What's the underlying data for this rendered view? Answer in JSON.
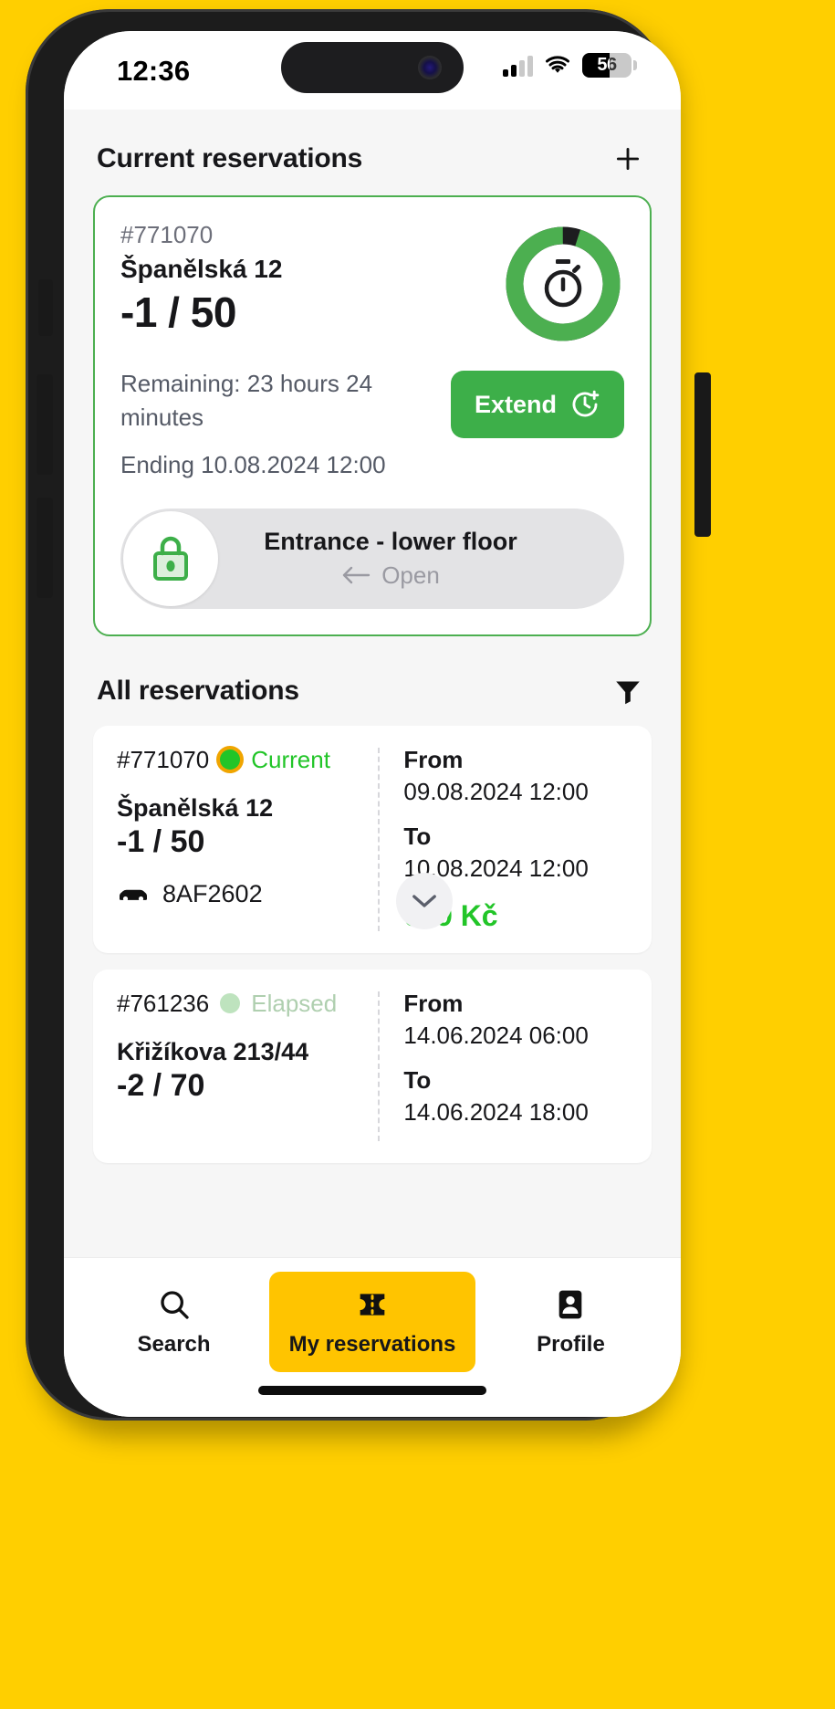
{
  "status_bar": {
    "time": "12:36",
    "battery_percent": "56",
    "battery_level": 56,
    "signal_icon": "cellular-signal-icon",
    "wifi_icon": "wifi-icon"
  },
  "colors": {
    "brand_yellow": "#FFCF00",
    "nav_active_yellow": "#FFC400",
    "green": "#3DAF49",
    "status_green": "#22C528",
    "card_border_green": "#4CAF50"
  },
  "header": {
    "title": "Current reservations",
    "add_icon": "plus-icon"
  },
  "current_reservation": {
    "id": "#771070",
    "address": "Španělská 12",
    "spot": "-1 / 50",
    "remaining": "Remaining: 23 hours 24 minutes",
    "ending": "Ending 10.08.2024 12:00",
    "extend_label": "Extend",
    "extend_icon": "clock-plus-icon",
    "timer_icon": "stopwatch-icon",
    "timer_progress_percent": 95,
    "door": {
      "lock_icon": "lock-icon",
      "title": "Entrance - lower floor",
      "hint": "Open",
      "hint_icon": "arrow-left-icon"
    }
  },
  "all_reservations": {
    "title": "All reservations",
    "filter_icon": "filter-icon",
    "column_labels": {
      "from": "From",
      "to": "To"
    },
    "items": [
      {
        "id": "#771070",
        "status": "Current",
        "status_kind": "current",
        "address": "Španělská 12",
        "spot": "-1 / 50",
        "plate": "8AF2602",
        "plate_icon": "car-icon",
        "from": "09.08.2024 12:00",
        "to": "10.08.2024 12:00",
        "price": "699 Kč",
        "expand_icon": "chevron-down-icon"
      },
      {
        "id": "#761236",
        "status": "Elapsed",
        "status_kind": "elapsed",
        "address": "Křižíkova 213/44",
        "spot": "-2 / 70",
        "plate": "",
        "plate_icon": "car-icon",
        "from": "14.06.2024 06:00",
        "to": "14.06.2024 18:00",
        "price": "",
        "expand_icon": "chevron-down-icon"
      }
    ]
  },
  "bottom_nav": {
    "items": [
      {
        "label": "Search",
        "icon": "search-icon",
        "active": false
      },
      {
        "label": "My reservations",
        "icon": "ticket-icon",
        "active": true
      },
      {
        "label": "Profile",
        "icon": "profile-card-icon",
        "active": false
      }
    ]
  }
}
